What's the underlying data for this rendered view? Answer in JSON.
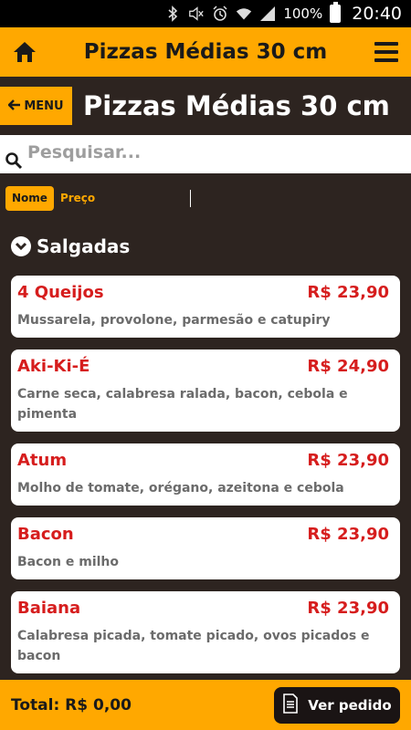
{
  "status_bar": {
    "battery": "100%",
    "time": "20:40",
    "icons": [
      "bluetooth-icon",
      "mute-icon",
      "alarm-icon",
      "wifi-icon",
      "signal-icon",
      "battery-icon"
    ]
  },
  "appbar": {
    "title": "Pizzas Médias 30 cm",
    "color": "#ffa800"
  },
  "header": {
    "menu_label": "MENU",
    "page_title": "Pizzas Médias 30 cm"
  },
  "search": {
    "placeholder": "Pesquisar..."
  },
  "sort": {
    "nome_label": "Nome",
    "preco_label": "Preço",
    "active": "Nome"
  },
  "category": {
    "label": "Salgadas"
  },
  "items": [
    {
      "name": "4 Queijos",
      "price": "R$ 23,90",
      "description": "Mussarela, provolone, parmesão e catupiry"
    },
    {
      "name": "Aki-Ki-É",
      "price": "R$ 24,90",
      "description": "Carne seca, calabresa ralada, bacon, cebola e pimenta"
    },
    {
      "name": "Atum",
      "price": "R$ 23,90",
      "description": "Molho de tomate, orégano, azeitona e cebola"
    },
    {
      "name": "Bacon",
      "price": "R$ 23,90",
      "description": "Bacon e milho"
    },
    {
      "name": "Baiana",
      "price": "R$ 23,90",
      "description": "Calabresa picada, tomate picado, ovos picados e bacon"
    }
  ],
  "footer": {
    "total_label": "Total: R$ 0,00",
    "order_button": "Ver pedido"
  },
  "colors": {
    "accent": "#ffa800",
    "background": "#2d2420",
    "price_red": "#d61d1d"
  }
}
